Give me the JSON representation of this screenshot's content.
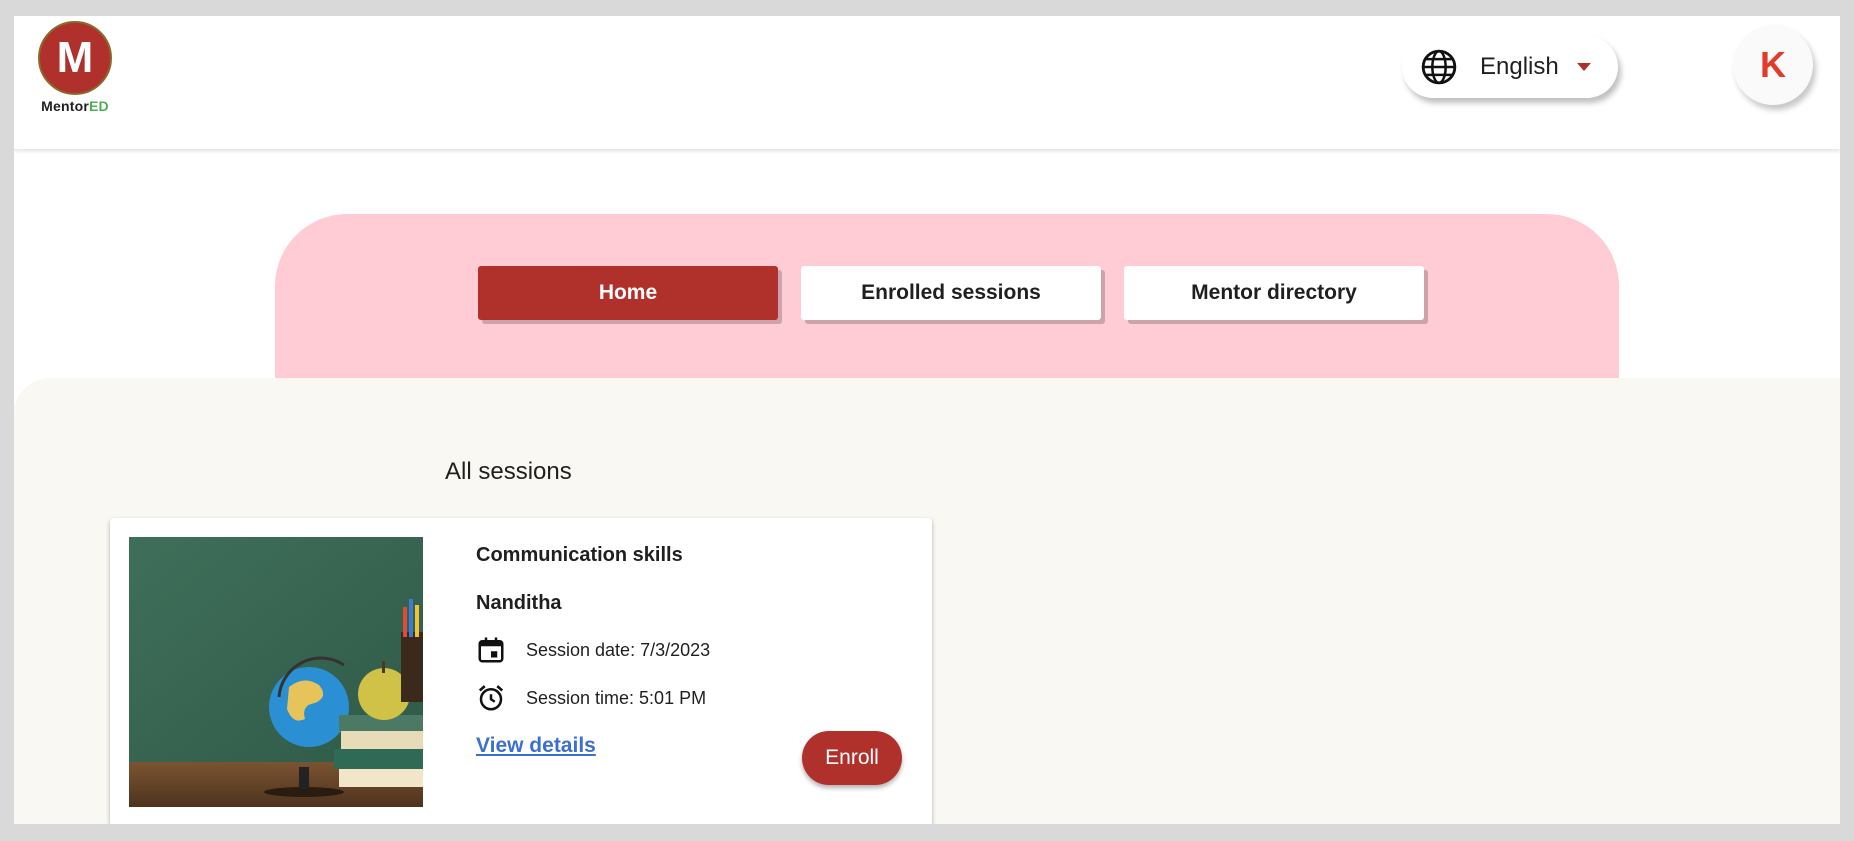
{
  "brand": {
    "name_main": "Mentor",
    "name_accent": "ED",
    "logo_letter": "M"
  },
  "header": {
    "language": "English",
    "avatar_initial": "K"
  },
  "tabs": [
    {
      "label": "Home",
      "active": true
    },
    {
      "label": "Enrolled sessions",
      "active": false
    },
    {
      "label": "Mentor directory",
      "active": false
    }
  ],
  "main": {
    "section_title": "All sessions",
    "session": {
      "title": "Communication skills",
      "mentor": "Nanditha",
      "date_text": "Session date: 7/3/2023",
      "time_text": "Session time: 5:01 PM",
      "view_details": "View details",
      "enroll": "Enroll"
    }
  },
  "colors": {
    "brand_red": "#b0312c",
    "tab_band": "#ffccd5",
    "content_bg": "#f9f8f3",
    "link": "#3d6fd1",
    "avatar_text": "#e23b2a",
    "accent_green": "#4caf50"
  },
  "icons": [
    "globe-icon",
    "caret-down-icon",
    "calendar-icon",
    "alarm-clock-icon"
  ]
}
